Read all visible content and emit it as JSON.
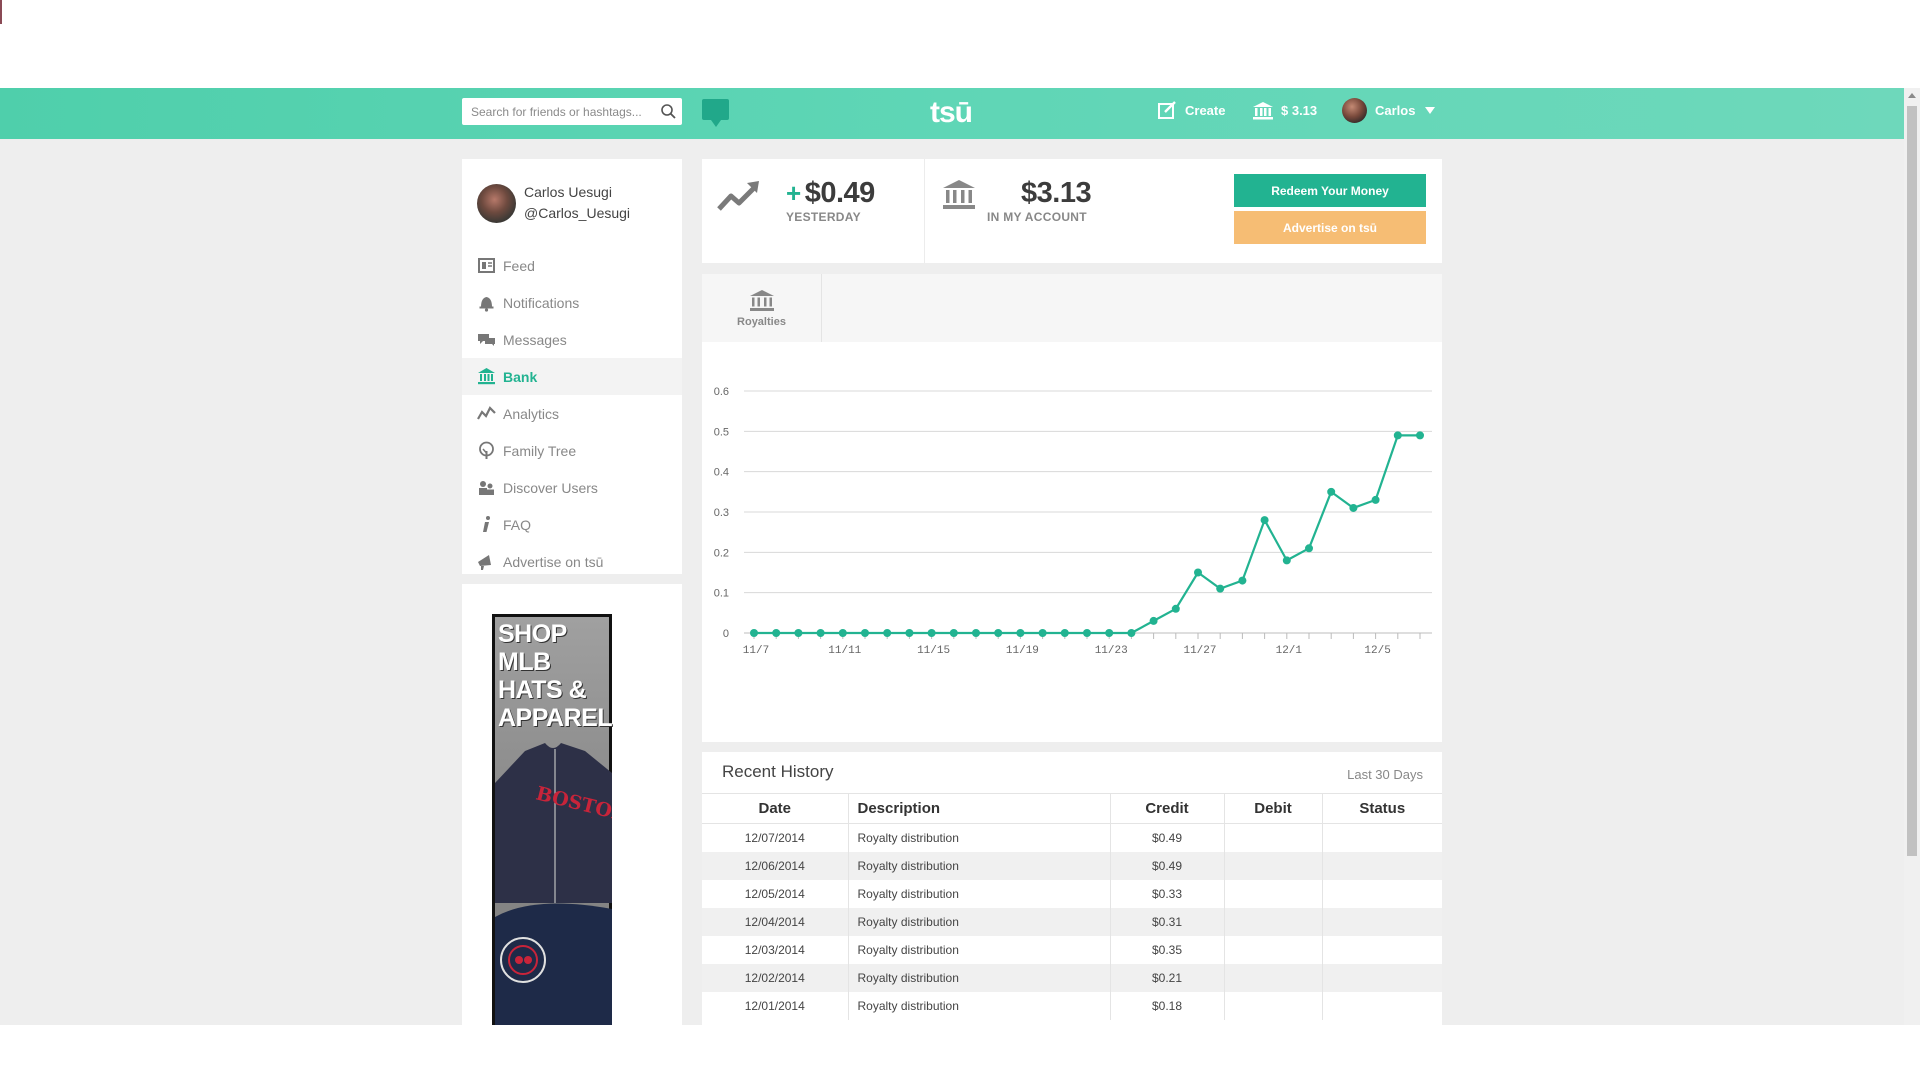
{
  "header": {
    "search_placeholder": "Search for friends or hashtags...",
    "logo": "tsū",
    "create_label": "Create",
    "balance_label": "$ 3.13",
    "user_name": "Carlos"
  },
  "sidebar": {
    "profile": {
      "name": "Carlos Uesugi",
      "handle": "@Carlos_Uesugi"
    },
    "items": [
      {
        "label": "Feed",
        "icon": "feed-icon"
      },
      {
        "label": "Notifications",
        "icon": "bell-icon"
      },
      {
        "label": "Messages",
        "icon": "messages-icon"
      },
      {
        "label": "Bank",
        "icon": "bank-icon",
        "active": true
      },
      {
        "label": "Analytics",
        "icon": "analytics-icon"
      },
      {
        "label": "Family Tree",
        "icon": "tree-icon"
      },
      {
        "label": "Discover Users",
        "icon": "users-icon"
      },
      {
        "label": "FAQ",
        "icon": "info-icon"
      },
      {
        "label": "Advertise on tsū",
        "icon": "megaphone-icon"
      }
    ]
  },
  "ad": {
    "text_lines": [
      "SHOP",
      "MLB",
      "HATS &",
      "APPAREL"
    ],
    "jersey_text": "BOSTON"
  },
  "stats": {
    "yesterday_value": "$0.49",
    "yesterday_prefix": "+",
    "yesterday_label": "YESTERDAY",
    "account_value": "$3.13",
    "account_label": "IN MY ACCOUNT",
    "redeem_label": "Redeem Your Money",
    "advertise_label": "Advertise on tsū"
  },
  "tabs": {
    "royalties_label": "Royalties"
  },
  "colors": {
    "accent": "#22b391",
    "advertise": "#f6bd74",
    "nav_start": "#4fcfab",
    "nav_end": "#6ed8bb"
  },
  "chart_data": {
    "type": "line",
    "x": [
      "11/7",
      "11/8",
      "11/9",
      "11/10",
      "11/11",
      "11/12",
      "11/13",
      "11/14",
      "11/15",
      "11/16",
      "11/17",
      "11/18",
      "11/19",
      "11/20",
      "11/21",
      "11/22",
      "11/23",
      "11/24",
      "11/25",
      "11/26",
      "11/27",
      "11/28",
      "11/29",
      "11/30",
      "12/1",
      "12/2",
      "12/3",
      "12/4",
      "12/5",
      "12/6",
      "12/7"
    ],
    "values": [
      0,
      0,
      0,
      0,
      0,
      0,
      0,
      0,
      0,
      0,
      0,
      0,
      0,
      0,
      0,
      0,
      0,
      0,
      0.03,
      0.06,
      0.15,
      0.11,
      0.13,
      0.28,
      0.18,
      0.21,
      0.35,
      0.31,
      0.33,
      0.49,
      0.49
    ],
    "x_tick_labels": [
      "11/7",
      "11/11",
      "11/15",
      "11/19",
      "11/23",
      "11/27",
      "12/1",
      "12/5"
    ],
    "y_ticks": [
      "0",
      "0.1",
      "0.2",
      "0.3",
      "0.4",
      "0.5",
      "0.6"
    ],
    "ylim": [
      0,
      0.6
    ],
    "grid": true,
    "color": "#22b391"
  },
  "history": {
    "title": "Recent History",
    "range": "Last 30 Days",
    "columns": [
      "Date",
      "Description",
      "Credit",
      "Debit",
      "Status"
    ],
    "rows": [
      {
        "date": "12/07/2014",
        "description": "Royalty distribution",
        "credit": "$0.49",
        "debit": "",
        "status": ""
      },
      {
        "date": "12/06/2014",
        "description": "Royalty distribution",
        "credit": "$0.49",
        "debit": "",
        "status": ""
      },
      {
        "date": "12/05/2014",
        "description": "Royalty distribution",
        "credit": "$0.33",
        "debit": "",
        "status": ""
      },
      {
        "date": "12/04/2014",
        "description": "Royalty distribution",
        "credit": "$0.31",
        "debit": "",
        "status": ""
      },
      {
        "date": "12/03/2014",
        "description": "Royalty distribution",
        "credit": "$0.35",
        "debit": "",
        "status": ""
      },
      {
        "date": "12/02/2014",
        "description": "Royalty distribution",
        "credit": "$0.21",
        "debit": "",
        "status": ""
      },
      {
        "date": "12/01/2014",
        "description": "Royalty distribution",
        "credit": "$0.18",
        "debit": "",
        "status": ""
      }
    ]
  }
}
